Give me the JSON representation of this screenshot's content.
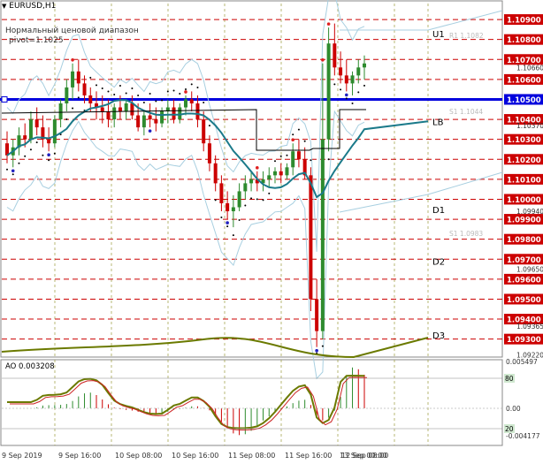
{
  "header": {
    "symbol": "EURUSD,H1",
    "indicator_line1": "Нормальный ценовой диапазон",
    "indicator_line2": "pivot=1.1025"
  },
  "ao": {
    "label": "AO 0.003208"
  },
  "colors": {
    "bull": "#2e8b2e",
    "bear": "#cc0000",
    "grid": "#cc0000",
    "pivot": "#0000dd",
    "ma": "#1b7a8a",
    "olive": "#6b7a00",
    "band": "#a8cfe0",
    "price_box": "#cc0000"
  },
  "chart_data": [
    {
      "type": "candlestick",
      "symbol": "EURUSD",
      "timeframe": "H1",
      "ylim": [
        1.0921,
        1.1098
      ],
      "price_levels": [
        "1.10900",
        "1.10800",
        "1.10700",
        "1.10600",
        "1.10500",
        "1.10400",
        "1.10300",
        "1.10200",
        "1.10100",
        "1.10000",
        "1.09900",
        "1.09800",
        "1.09700",
        "1.09600",
        "1.09500",
        "1.09400",
        "1.09300"
      ],
      "other_labels": [
        "1.10660",
        "1.10370",
        "1.09940",
        "1.09650",
        "1.09365",
        "1.09220"
      ],
      "pivot_label": "1.10500",
      "level_names": [
        {
          "name": "U1",
          "price": 1.1083
        },
        {
          "name": "LB",
          "price": 1.1039
        },
        {
          "name": "D1",
          "price": 1.0995
        },
        {
          "name": "D2",
          "price": 1.0969
        },
        {
          "name": "D3",
          "price": 1.0932
        }
      ],
      "faded_labels": [
        "R1 1.1082",
        "S1 1.1044",
        "S1 1.0983"
      ],
      "x_labels": [
        "9 Sep 2019",
        "9 Sep 16:00",
        "10 Sep 08:00",
        "10 Sep 16:00",
        "11 Sep 08:00",
        "11 Sep 16:00",
        "12 Sep 08:00",
        "13 Sep 00:00"
      ],
      "candles": [
        [
          1.1028,
          1.1034,
          1.1018,
          1.1022
        ],
        [
          1.1022,
          1.103,
          1.1016,
          1.1026
        ],
        [
          1.1026,
          1.1036,
          1.1022,
          1.1032
        ],
        [
          1.1032,
          1.1038,
          1.1026,
          1.103
        ],
        [
          1.103,
          1.1044,
          1.1028,
          1.104
        ],
        [
          1.104,
          1.1046,
          1.1032,
          1.1036
        ],
        [
          1.1036,
          1.1042,
          1.1026,
          1.103
        ],
        [
          1.103,
          1.1036,
          1.1024,
          1.1028
        ],
        [
          1.1028,
          1.1042,
          1.1026,
          1.104
        ],
        [
          1.104,
          1.105,
          1.1036,
          1.1048
        ],
        [
          1.1048,
          1.106,
          1.1044,
          1.1056
        ],
        [
          1.1056,
          1.1068,
          1.105,
          1.1064
        ],
        [
          1.1064,
          1.107,
          1.1054,
          1.1058
        ],
        [
          1.1058,
          1.1062,
          1.1048,
          1.1052
        ],
        [
          1.1052,
          1.1056,
          1.1044,
          1.1048
        ],
        [
          1.1048,
          1.1054,
          1.104,
          1.1046
        ],
        [
          1.1046,
          1.1052,
          1.1038,
          1.1044
        ],
        [
          1.1044,
          1.105,
          1.1036,
          1.104
        ],
        [
          1.104,
          1.1048,
          1.1036,
          1.1046
        ],
        [
          1.1046,
          1.1052,
          1.104,
          1.1044
        ],
        [
          1.1044,
          1.105,
          1.104,
          1.1048
        ],
        [
          1.1048,
          1.1052,
          1.104,
          1.1042
        ],
        [
          1.1042,
          1.1048,
          1.1034,
          1.1036
        ],
        [
          1.1036,
          1.1044,
          1.1032,
          1.1042
        ],
        [
          1.1042,
          1.1048,
          1.1036,
          1.104
        ],
        [
          1.104,
          1.1046,
          1.1034,
          1.1038
        ],
        [
          1.1038,
          1.1046,
          1.1036,
          1.1044
        ],
        [
          1.1044,
          1.105,
          1.1038,
          1.1046
        ],
        [
          1.1046,
          1.105,
          1.1038,
          1.104
        ],
        [
          1.104,
          1.1048,
          1.1038,
          1.1046
        ],
        [
          1.1046,
          1.1052,
          1.1042,
          1.105
        ],
        [
          1.105,
          1.1054,
          1.1044,
          1.1048
        ],
        [
          1.1048,
          1.1052,
          1.1036,
          1.104
        ],
        [
          1.104,
          1.1044,
          1.1024,
          1.1028
        ],
        [
          1.1028,
          1.1032,
          1.1014,
          1.1018
        ],
        [
          1.1018,
          1.1022,
          1.1004,
          1.1008
        ],
        [
          1.1008,
          1.1012,
          1.0994,
          1.0998
        ],
        [
          1.0998,
          1.1004,
          1.099,
          1.0994
        ],
        [
          1.0994,
          1.1002,
          1.0986,
          1.0996
        ],
        [
          1.0996,
          1.1008,
          1.0994,
          1.1004
        ],
        [
          1.1004,
          1.1012,
          1.1,
          1.1008
        ],
        [
          1.1008,
          1.1014,
          1.1004,
          1.101
        ],
        [
          1.101,
          1.1014,
          1.1004,
          1.1008
        ],
        [
          1.1008,
          1.1014,
          1.1004,
          1.101
        ],
        [
          1.101,
          1.1016,
          1.1006,
          1.1012
        ],
        [
          1.1012,
          1.1016,
          1.1008,
          1.1014
        ],
        [
          1.1014,
          1.1018,
          1.1008,
          1.1012
        ],
        [
          1.1012,
          1.1018,
          1.101,
          1.1016
        ],
        [
          1.1016,
          1.1028,
          1.1012,
          1.1024
        ],
        [
          1.1024,
          1.103,
          1.1016,
          1.102
        ],
        [
          1.102,
          1.1026,
          1.101,
          1.1012
        ],
        [
          1.1012,
          1.1016,
          1.0944,
          1.095
        ],
        [
          1.095,
          1.096,
          1.0926,
          1.0934
        ],
        [
          1.0934,
          1.1068,
          1.093,
          1.103
        ],
        [
          1.103,
          1.1086,
          1.1024,
          1.1078
        ],
        [
          1.1078,
          1.1088,
          1.1062,
          1.1066
        ],
        [
          1.1066,
          1.1074,
          1.1058,
          1.1062
        ],
        [
          1.1062,
          1.107,
          1.1054,
          1.1058
        ],
        [
          1.1058,
          1.1064,
          1.1052,
          1.1062
        ],
        [
          1.1062,
          1.107,
          1.1058,
          1.1066
        ],
        [
          1.1066,
          1.1072,
          1.106,
          1.1068
        ]
      ],
      "ao_series": {
        "name": "AO",
        "ylim": [
          -0.004177,
          0.005497
        ],
        "levels": [
          "0.005497",
          "0.00",
          "-0.004177"
        ],
        "zone_labels": [
          "80",
          "20"
        ]
      }
    }
  ]
}
